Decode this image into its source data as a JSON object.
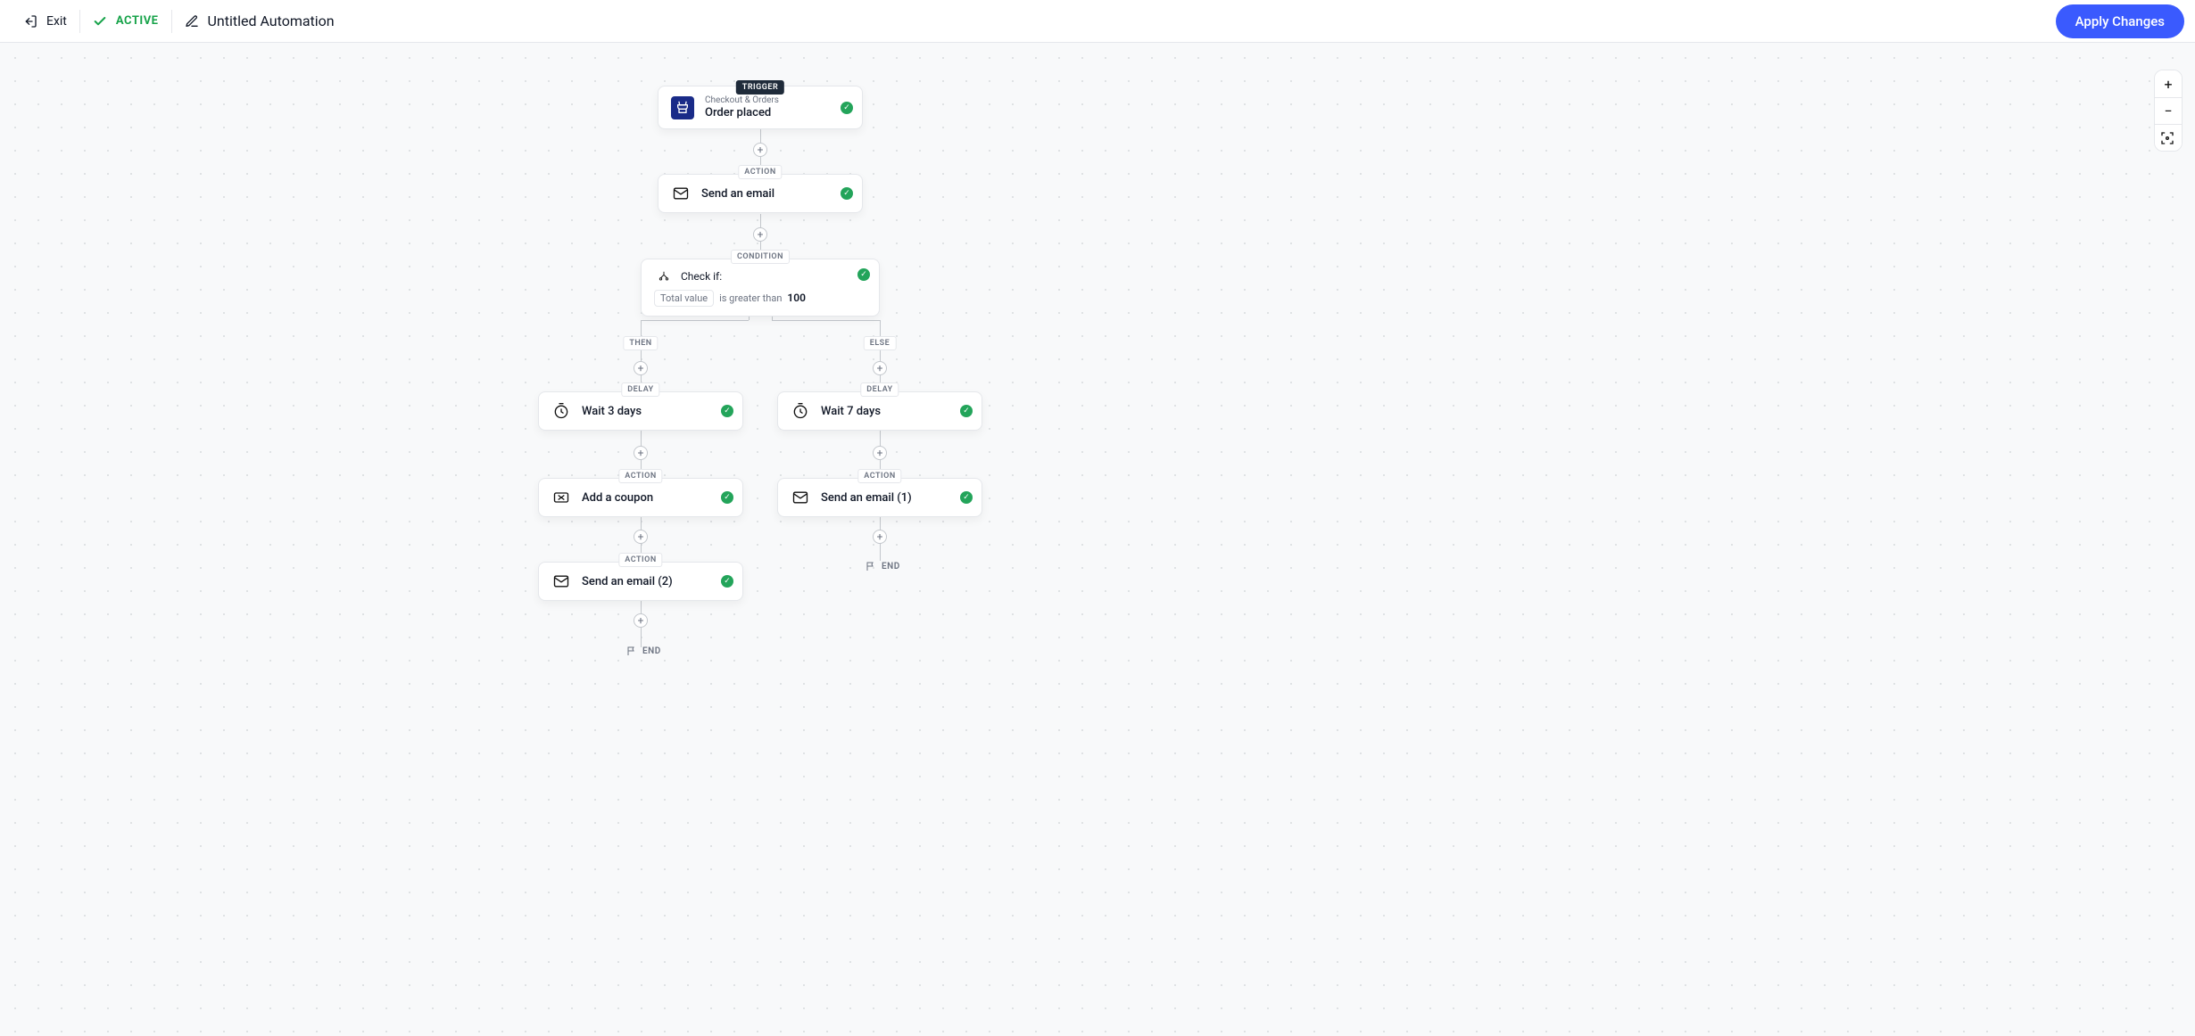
{
  "header": {
    "exit_label": "Exit",
    "status_text": "ACTIVE",
    "title": "Untitled Automation",
    "apply_label": "Apply Changes"
  },
  "labels": {
    "trigger": "TRIGGER",
    "action": "ACTION",
    "condition": "CONDITION",
    "delay": "DELAY",
    "then": "THEN",
    "else": "ELSE",
    "end": "END"
  },
  "nodes": {
    "trigger": {
      "category": "Checkout & Orders",
      "title": "Order placed"
    },
    "action1": {
      "title": "Send an email"
    },
    "condition": {
      "heading": "Check if:",
      "field": "Total value",
      "operator": "is greater than",
      "value": "100"
    },
    "then": {
      "delay": {
        "title": "Wait 3 days"
      },
      "action1": {
        "title": "Add a coupon"
      },
      "action2": {
        "title": "Send an email (2)"
      }
    },
    "else": {
      "delay": {
        "title": "Wait 7 days"
      },
      "action1": {
        "title": "Send an email (1)"
      }
    }
  }
}
